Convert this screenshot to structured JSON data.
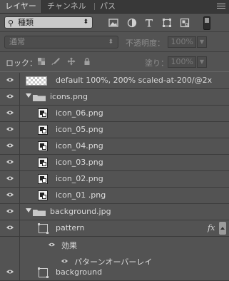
{
  "tabs": [
    {
      "label": "レイヤー",
      "active": true
    },
    {
      "label": "チャンネル",
      "active": false
    },
    {
      "label": "パス",
      "active": false
    }
  ],
  "filter": {
    "kind_label": "種類",
    "icons": [
      "pixel-filter-icon",
      "adjustment-filter-icon",
      "type-filter-icon",
      "shape-filter-icon",
      "smart-object-filter-icon"
    ]
  },
  "blend": {
    "mode": "通常",
    "opacity_label": "不透明度：",
    "opacity_value": "100%"
  },
  "lock": {
    "label": "ロック：",
    "fill_label": "塗り：",
    "fill_value": "100%"
  },
  "layers": [
    {
      "name": "default 100%, 200% scaled-at-200/@2x",
      "type": "pixel"
    },
    {
      "name": "icons.png",
      "type": "group"
    },
    {
      "name": "icon_06.png",
      "type": "smart"
    },
    {
      "name": "icon_05.png",
      "type": "smart"
    },
    {
      "name": "icon_04.png",
      "type": "smart"
    },
    {
      "name": "icon_03.png",
      "type": "smart"
    },
    {
      "name": "icon_02.png",
      "type": "smart"
    },
    {
      "name": "icon_01 .png",
      "type": "smart"
    },
    {
      "name": "background.jpg",
      "type": "group"
    },
    {
      "name": "pattern",
      "type": "shape",
      "fx": "fx"
    },
    {
      "name": "効果",
      "type": "effects"
    },
    {
      "name": "パターンオーバーレイ",
      "type": "effect-item"
    },
    {
      "name": "background",
      "type": "shape"
    }
  ],
  "colors": {
    "panel_bg": "#535353",
    "tab_bar_bg": "#383838",
    "text": "#dadada"
  }
}
